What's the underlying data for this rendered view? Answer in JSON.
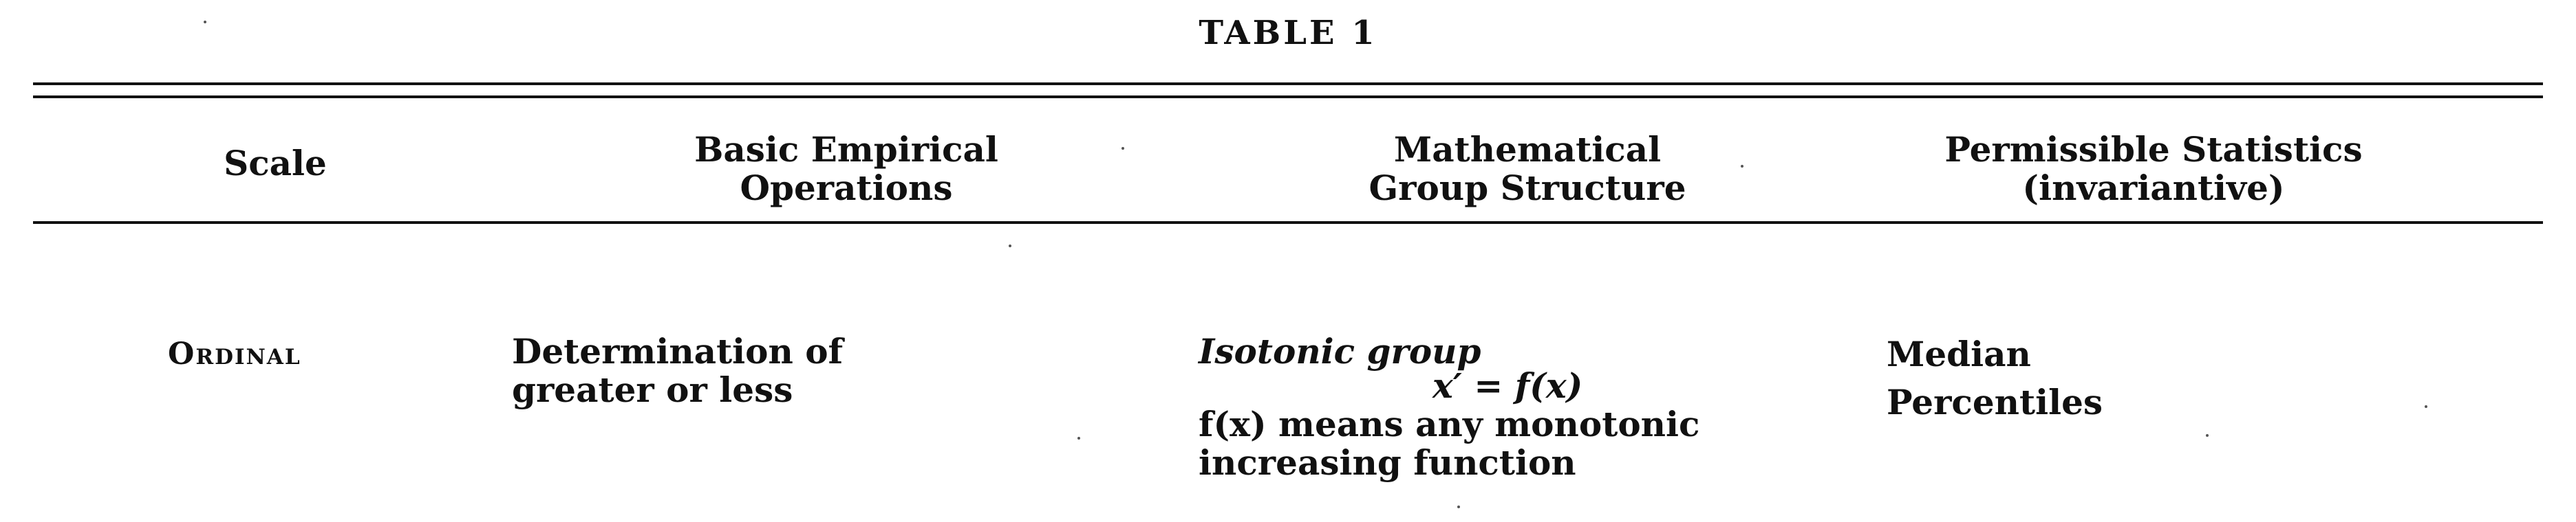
{
  "table": {
    "title": "TABLE 1",
    "headers": {
      "scale": "Scale",
      "operations": [
        "Basic Empirical",
        "Operations"
      ],
      "group_structure": [
        "Mathematical",
        "Group Structure"
      ],
      "statistics": [
        "Permissible Statistics",
        "(invariantive)"
      ]
    },
    "rows": [
      {
        "scale": "Ordinal",
        "operations": [
          "Determination of",
          "greater or less"
        ],
        "group_structure": {
          "name": "Isotonic group",
          "formula": "x′ = f(x)",
          "description": [
            "f(x) means any monotonic",
            "increasing function"
          ]
        },
        "statistics": [
          "Median",
          "Percentiles"
        ]
      }
    ]
  }
}
